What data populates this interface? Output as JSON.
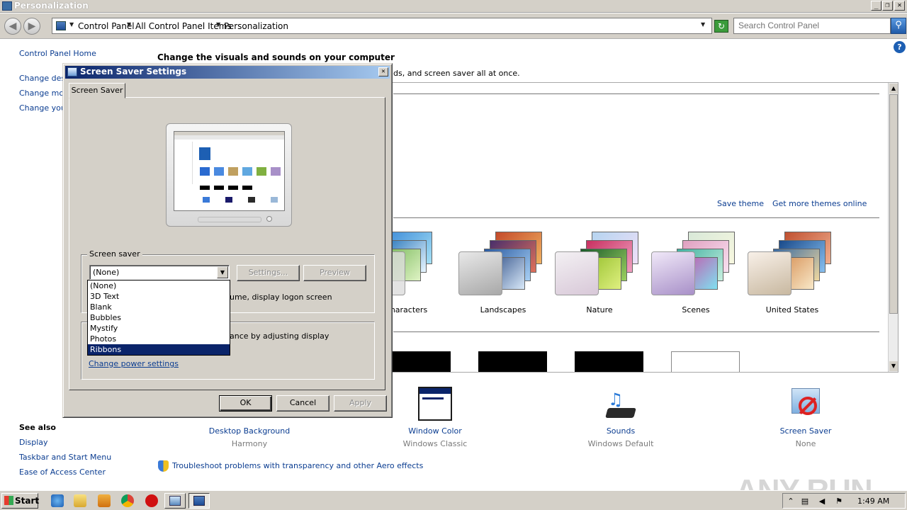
{
  "window": {
    "title": "Personalization",
    "controls": {
      "minimize": "_",
      "maximize": "❐",
      "close": "✕"
    }
  },
  "address": {
    "crumbs": [
      "Control Panel",
      "All Control Panel Items",
      "Personalization"
    ],
    "search_placeholder": "Search Control Panel"
  },
  "sidebar": {
    "home": "Control Panel Home",
    "links": [
      "Change desk",
      "Change mou",
      "Change your"
    ],
    "see_also_title": "See also",
    "see_also": [
      "Display",
      "Taskbar and Start Menu",
      "Ease of Access Center"
    ]
  },
  "main": {
    "heading": "Change the visuals and sounds on your computer",
    "subheading": "ds, and screen saver all at once.",
    "save_theme": "Save theme",
    "get_more": "Get more themes online",
    "themes": [
      {
        "name": "haracters"
      },
      {
        "name": "Landscapes"
      },
      {
        "name": "Nature"
      },
      {
        "name": "Scenes"
      },
      {
        "name": "United States"
      }
    ],
    "troubleshoot": "Troubleshoot problems with transparency and other Aero effects"
  },
  "bottom": [
    {
      "label": "Desktop Background",
      "sub": "Harmony"
    },
    {
      "label": "Window Color",
      "sub": "Windows Classic"
    },
    {
      "label": "Sounds",
      "sub": "Windows Default"
    },
    {
      "label": "Screen Saver",
      "sub": "None"
    }
  ],
  "dialog": {
    "title": "Screen Saver Settings",
    "tab": "Screen Saver",
    "group_screensaver": "Screen saver",
    "selected": "(None)",
    "settings_btn": "Settings...",
    "preview_btn": "Preview",
    "logon_text": "ume, display logon screen",
    "power_text": "ance by adjusting display",
    "power_link": "Change power settings",
    "ok": "OK",
    "cancel": "Cancel",
    "apply": "Apply",
    "options": [
      "(None)",
      "3D Text",
      "Blank",
      "Bubbles",
      "Mystify",
      "Photos",
      "Ribbons"
    ],
    "highlighted_option": "Ribbons"
  },
  "taskbar": {
    "start": "Start",
    "clock": "1:49 AM"
  },
  "watermark": "ANY RUN",
  "colors": {
    "accent": "#0a246a",
    "link": "#0b3d91",
    "chrome": "#d4d0c8"
  }
}
